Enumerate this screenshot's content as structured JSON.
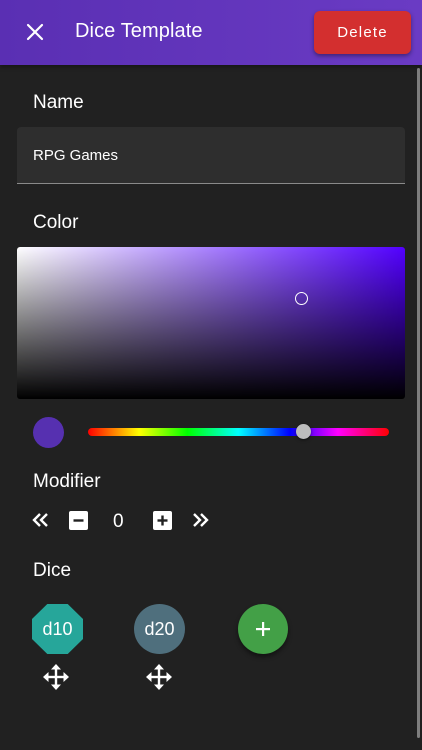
{
  "appbar": {
    "title": "Dice Template",
    "delete_label": "Delete",
    "close_icon": "close-icon"
  },
  "name_section": {
    "label": "Name",
    "value": "RPG Games"
  },
  "color_section": {
    "label": "Color",
    "selected_color": "#5630b0",
    "hue_color": "#5200ff"
  },
  "modifier_section": {
    "label": "Modifier",
    "value": "0",
    "icons": [
      "double-chevron-left-icon",
      "minus-box-icon",
      "plus-box-icon",
      "double-chevron-right-icon"
    ]
  },
  "dice_section": {
    "label": "Dice",
    "dice": [
      {
        "label": "d10",
        "color": "#26a69a"
      },
      {
        "label": "d20",
        "color": "#4f6f7d"
      }
    ],
    "add_color": "#43a047"
  },
  "colors": {
    "appbar": "#5a2fb3",
    "delete": "#d32f2f",
    "background": "#212121"
  }
}
